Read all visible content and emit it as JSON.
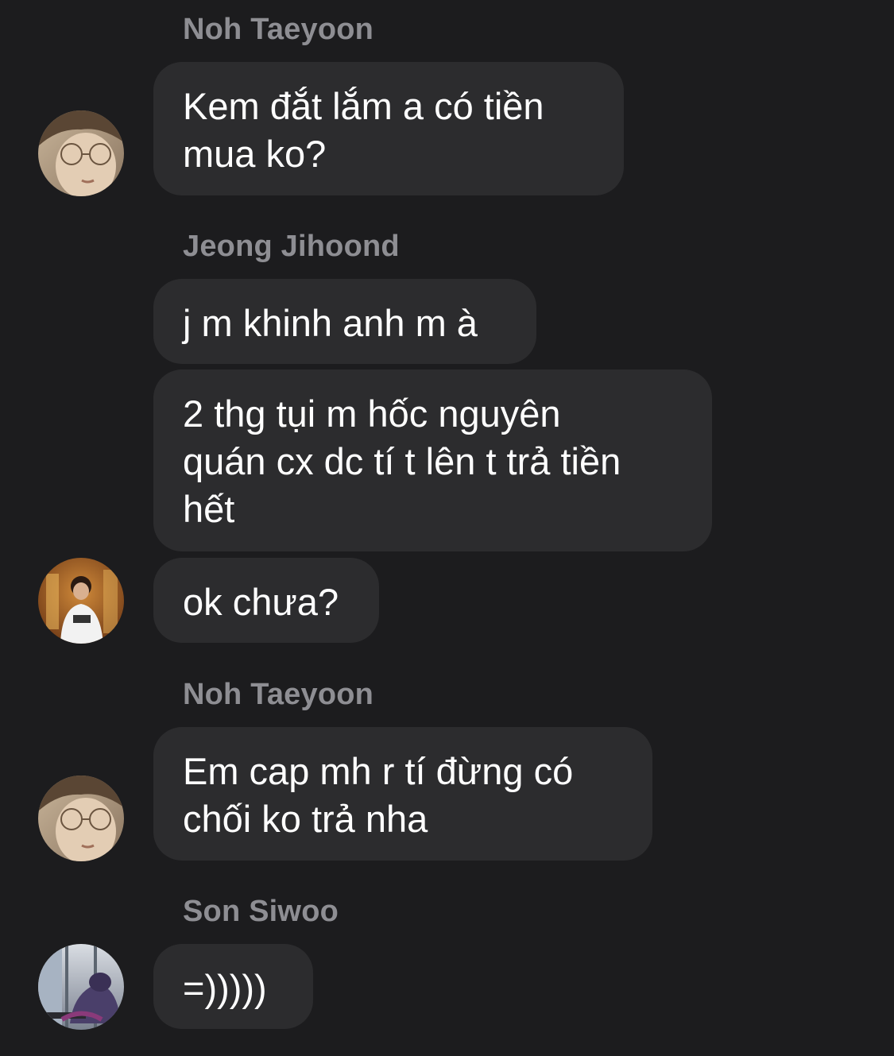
{
  "messages_group_1": {
    "sender": "Noh Taeyoon",
    "bubble_1": "Kem đắt lắm a có tiền\nmua ko?"
  },
  "messages_group_2": {
    "sender": "Jeong Jihoond",
    "bubble_1": "j m khinh anh m à",
    "bubble_2": "2 thg tụi m hốc nguyên\nquán cx dc tí t lên t trả tiền\nhết",
    "bubble_3": "ok chưa?"
  },
  "messages_group_3": {
    "sender": "Noh Taeyoon",
    "bubble_1": "Em cap mh r tí đừng có\nchối ko trả nha"
  },
  "messages_group_4": {
    "sender": "Son Siwoo",
    "bubble_1": "=)))))"
  },
  "colors": {
    "background": "#1c1c1e",
    "bubble": "#2c2c2e",
    "sender_name": "#8e8e93",
    "text": "#ffffff"
  }
}
